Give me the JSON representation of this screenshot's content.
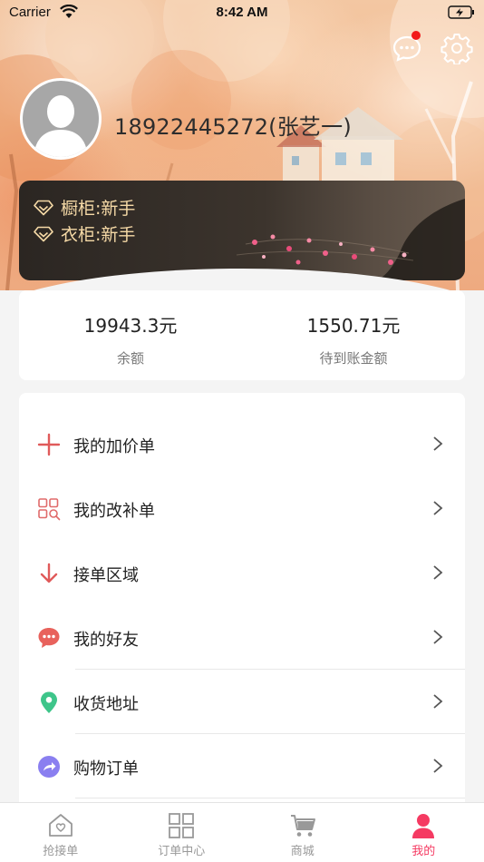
{
  "status_bar": {
    "carrier": "Carrier",
    "time": "8:42 AM"
  },
  "header": {
    "message_icon": "message-icon",
    "settings_icon": "gear-icon",
    "username": "18922445272(张艺一)",
    "levels": [
      {
        "label": "橱柜:新手",
        "icon": "diamond-icon"
      },
      {
        "label": "衣柜:新手",
        "icon": "diamond-icon"
      }
    ]
  },
  "balance": {
    "items": [
      {
        "value": "19943.3元",
        "label": "余额"
      },
      {
        "value": "1550.71元",
        "label": "待到账金额"
      }
    ]
  },
  "menu": {
    "items": [
      {
        "label": "我的加价单",
        "icon": "plus-icon"
      },
      {
        "label": "我的改补单",
        "icon": "grid-search-icon"
      },
      {
        "label": "接单区域",
        "icon": "arrow-down-icon"
      },
      {
        "label": "我的好友",
        "icon": "chat-bubble-icon"
      },
      {
        "label": "收货地址",
        "icon": "location-pin-icon"
      },
      {
        "label": "购物订单",
        "icon": "share-arrow-icon"
      }
    ]
  },
  "tabbar": {
    "items": [
      {
        "label": "抢接单",
        "icon": "house-heart-icon",
        "active": false
      },
      {
        "label": "订单中心",
        "icon": "grid-icon",
        "active": false
      },
      {
        "label": "商城",
        "icon": "cart-icon",
        "active": false
      },
      {
        "label": "我的",
        "icon": "person-icon",
        "active": true
      }
    ]
  },
  "colors": {
    "accent": "#f53a62",
    "level_text": "#f5d9a6",
    "plus_icon": "#e05a5a",
    "chat_icon": "#e8625c",
    "pin_icon": "#3ec58a",
    "share_icon": "#8a7ff0"
  }
}
